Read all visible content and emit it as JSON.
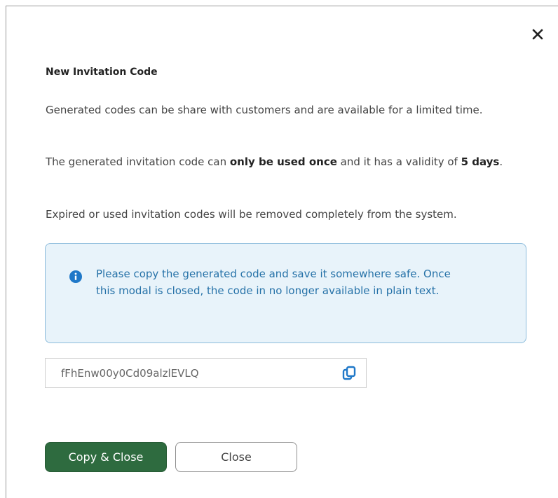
{
  "modal": {
    "title": "New Invitation Code",
    "paragraph1": "Generated codes can be share with customers and are available for a limited time.",
    "paragraph2": {
      "before": "The generated invitation code can ",
      "bold1": "only be used once",
      "middle": " and it has a validity of ",
      "bold2": "5 days",
      "end": "."
    },
    "paragraph3": "Expired or used invitation codes will be removed completely from the system.",
    "info": {
      "icon": "info-icon",
      "text": "Please copy the generated code and save it somewhere safe. Once this modal is closed, the code in no longer available in plain text."
    },
    "code": {
      "value": "fFhEnw00y0Cd09alzlEVLQ",
      "copy_icon": "copy-icon"
    },
    "buttons": {
      "copy_close": "Copy & Close",
      "close": "Close"
    },
    "close_icon": "close-icon"
  },
  "colors": {
    "primary_button": "#2e6b3f",
    "info_background": "#e8f3fa",
    "info_border": "#8dbcdc",
    "info_text": "#2672a8",
    "info_icon": "#1f78c8",
    "copy_icon": "#1f78c8"
  }
}
